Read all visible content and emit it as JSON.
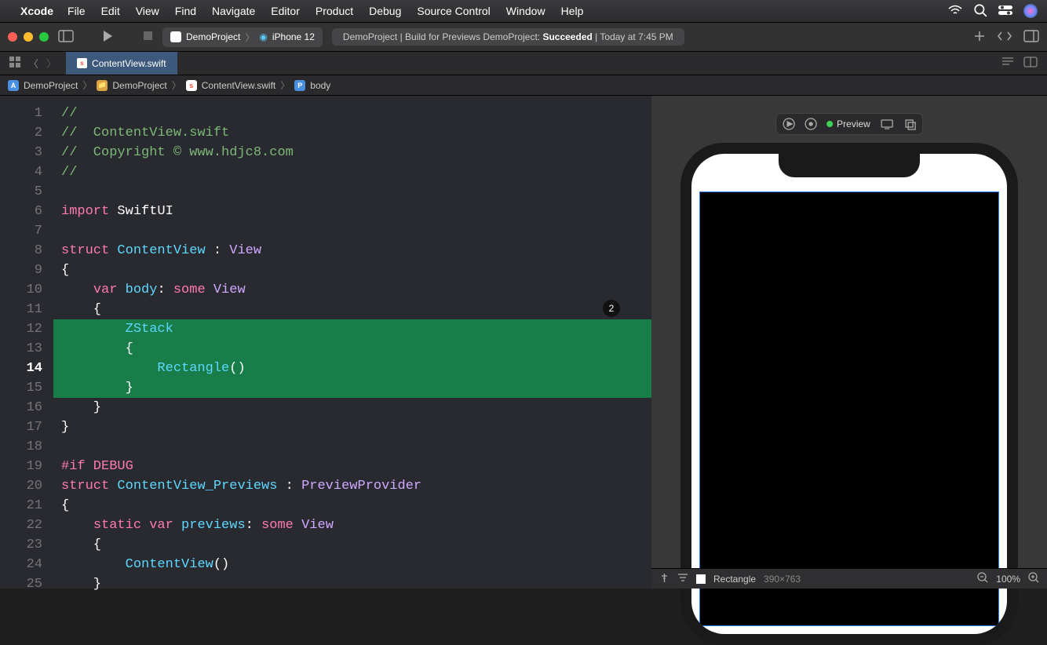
{
  "menubar": {
    "app": "Xcode",
    "items": [
      "File",
      "Edit",
      "View",
      "Find",
      "Navigate",
      "Editor",
      "Product",
      "Debug",
      "Source Control",
      "Window",
      "Help"
    ]
  },
  "toolbar": {
    "traffic": {
      "close": "#ff5f57",
      "min": "#febc2e",
      "max": "#28c840"
    },
    "scheme_project": "DemoProject",
    "scheme_device": "iPhone 12",
    "status_prefix": "DemoProject | Build for Previews DemoProject: ",
    "status_result": "Succeeded",
    "status_time": " | Today at 7:45 PM"
  },
  "tabbar": {
    "active_tab": "ContentView.swift"
  },
  "breadcrumb": {
    "items": [
      "DemoProject",
      "DemoProject",
      "ContentView.swift",
      "body"
    ]
  },
  "code": {
    "current_line": 14,
    "badge": "2",
    "lines": [
      {
        "n": 1,
        "hl": false,
        "tokens": [
          {
            "t": "//",
            "c": "c-comment"
          }
        ]
      },
      {
        "n": 2,
        "hl": false,
        "tokens": [
          {
            "t": "//  ContentView.swift",
            "c": "c-comment"
          }
        ]
      },
      {
        "n": 3,
        "hl": false,
        "tokens": [
          {
            "t": "//  Copyright © www.hdjc8.com",
            "c": "c-comment"
          }
        ]
      },
      {
        "n": 4,
        "hl": false,
        "tokens": [
          {
            "t": "//",
            "c": "c-comment"
          }
        ]
      },
      {
        "n": 5,
        "hl": false,
        "tokens": [
          {
            "t": "",
            "c": "c-plain"
          }
        ]
      },
      {
        "n": 6,
        "hl": false,
        "tokens": [
          {
            "t": "import",
            "c": "c-keyword"
          },
          {
            "t": " SwiftUI",
            "c": "c-plain"
          }
        ]
      },
      {
        "n": 7,
        "hl": false,
        "tokens": [
          {
            "t": "",
            "c": "c-plain"
          }
        ]
      },
      {
        "n": 8,
        "hl": false,
        "tokens": [
          {
            "t": "struct",
            "c": "c-keyword"
          },
          {
            "t": " ",
            "c": "c-plain"
          },
          {
            "t": "ContentView",
            "c": "c-type2"
          },
          {
            "t": " : ",
            "c": "c-plain"
          },
          {
            "t": "View",
            "c": "c-type3"
          }
        ]
      },
      {
        "n": 9,
        "hl": false,
        "tokens": [
          {
            "t": "{",
            "c": "c-plain"
          }
        ]
      },
      {
        "n": 10,
        "hl": false,
        "tokens": [
          {
            "t": "    ",
            "c": "c-plain"
          },
          {
            "t": "var",
            "c": "c-keyword"
          },
          {
            "t": " ",
            "c": "c-plain"
          },
          {
            "t": "body",
            "c": "c-type2"
          },
          {
            "t": ": ",
            "c": "c-plain"
          },
          {
            "t": "some",
            "c": "c-keyword"
          },
          {
            "t": " ",
            "c": "c-plain"
          },
          {
            "t": "View",
            "c": "c-type3"
          }
        ]
      },
      {
        "n": 11,
        "hl": false,
        "tokens": [
          {
            "t": "    {",
            "c": "c-plain"
          }
        ]
      },
      {
        "n": 12,
        "hl": true,
        "tokens": [
          {
            "t": "        ",
            "c": "c-plain"
          },
          {
            "t": "ZStack",
            "c": "c-type2"
          }
        ]
      },
      {
        "n": 13,
        "hl": true,
        "tokens": [
          {
            "t": "        {",
            "c": "c-plain"
          }
        ]
      },
      {
        "n": 14,
        "hl": true,
        "tokens": [
          {
            "t": "            ",
            "c": "c-plain"
          },
          {
            "t": "Rectangle",
            "c": "c-type2"
          },
          {
            "t": "()",
            "c": "c-plain"
          }
        ]
      },
      {
        "n": 15,
        "hl": true,
        "tokens": [
          {
            "t": "        }",
            "c": "c-plain"
          }
        ]
      },
      {
        "n": 16,
        "hl": false,
        "tokens": [
          {
            "t": "    }",
            "c": "c-plain"
          }
        ]
      },
      {
        "n": 17,
        "hl": false,
        "tokens": [
          {
            "t": "}",
            "c": "c-plain"
          }
        ]
      },
      {
        "n": 18,
        "hl": false,
        "tokens": [
          {
            "t": "",
            "c": "c-plain"
          }
        ]
      },
      {
        "n": 19,
        "hl": false,
        "tokens": [
          {
            "t": "#if",
            "c": "c-keyword"
          },
          {
            "t": " DEBUG",
            "c": "c-keyword"
          }
        ]
      },
      {
        "n": 20,
        "hl": false,
        "tokens": [
          {
            "t": "struct",
            "c": "c-keyword"
          },
          {
            "t": " ",
            "c": "c-plain"
          },
          {
            "t": "ContentView_Previews",
            "c": "c-type2"
          },
          {
            "t": " : ",
            "c": "c-plain"
          },
          {
            "t": "PreviewProvider",
            "c": "c-type3"
          }
        ]
      },
      {
        "n": 21,
        "hl": false,
        "tokens": [
          {
            "t": "{",
            "c": "c-plain"
          }
        ]
      },
      {
        "n": 22,
        "hl": false,
        "tokens": [
          {
            "t": "    ",
            "c": "c-plain"
          },
          {
            "t": "static",
            "c": "c-keyword"
          },
          {
            "t": " ",
            "c": "c-plain"
          },
          {
            "t": "var",
            "c": "c-keyword"
          },
          {
            "t": " ",
            "c": "c-plain"
          },
          {
            "t": "previews",
            "c": "c-type2"
          },
          {
            "t": ": ",
            "c": "c-plain"
          },
          {
            "t": "some",
            "c": "c-keyword"
          },
          {
            "t": " ",
            "c": "c-plain"
          },
          {
            "t": "View",
            "c": "c-type3"
          }
        ]
      },
      {
        "n": 23,
        "hl": false,
        "tokens": [
          {
            "t": "    {",
            "c": "c-plain"
          }
        ]
      },
      {
        "n": 24,
        "hl": false,
        "tokens": [
          {
            "t": "        ",
            "c": "c-plain"
          },
          {
            "t": "ContentView",
            "c": "c-type2"
          },
          {
            "t": "()",
            "c": "c-plain"
          }
        ]
      },
      {
        "n": 25,
        "hl": false,
        "tokens": [
          {
            "t": "    }",
            "c": "c-plain"
          }
        ]
      }
    ]
  },
  "preview": {
    "live_label": "Preview",
    "footer_element": "Rectangle",
    "footer_size": "390×763",
    "zoom": "100%"
  }
}
